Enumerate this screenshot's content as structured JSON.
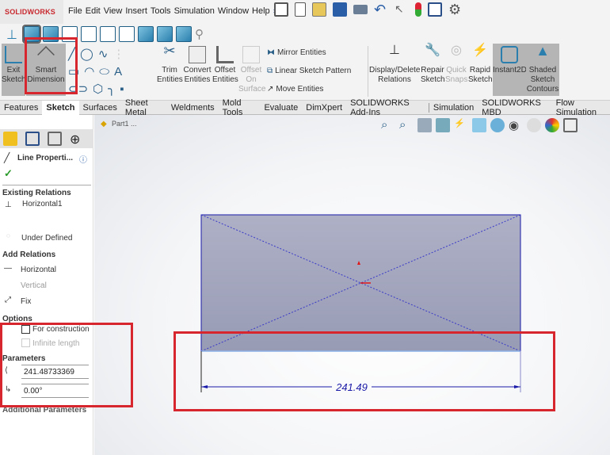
{
  "app": {
    "logo": "SOLIDWORKS"
  },
  "menu": [
    "File",
    "Edit",
    "View",
    "Insert",
    "Tools",
    "Simulation",
    "Window",
    "Help"
  ],
  "quick_access": [
    "home-icon",
    "new-document-icon",
    "open-icon",
    "save-icon",
    "print-icon",
    "undo-icon",
    "select-icon",
    "rebuild-icon",
    "file-properties-icon",
    "options-icon"
  ],
  "ribbon": {
    "exit_sketch": "Exit Sketch",
    "smart_dimension": "Smart Dimension",
    "trim": "Trim Entities",
    "convert": "Convert Entities",
    "offset": "Offset Entities",
    "offset_surface": "Offset On Surface",
    "mirror": "Mirror Entities",
    "linear_pattern": "Linear Sketch Pattern",
    "move": "Move Entities",
    "display_delete": "Display/Delete Relations",
    "repair": "Repair Sketch",
    "quick_snaps": "Quick Snaps",
    "rapid": "Rapid Sketch",
    "instant2d": "Instant2D",
    "shaded": "Shaded Sketch Contours"
  },
  "tabs": [
    {
      "label": "Features"
    },
    {
      "label": "Sketch",
      "active": true
    },
    {
      "label": "Surfaces"
    },
    {
      "label": "Sheet Metal"
    },
    {
      "label": "Weldments"
    },
    {
      "label": "Mold Tools"
    },
    {
      "label": "Evaluate"
    },
    {
      "label": "DimXpert"
    },
    {
      "label": "SOLIDWORKS Add-Ins"
    },
    {
      "label": "Simulation"
    },
    {
      "label": "SOLIDWORKS MBD"
    },
    {
      "label": "Flow Simulation"
    }
  ],
  "tree": {
    "part": "Part1 ..."
  },
  "panel": {
    "title": "Line Properti...",
    "existing_relations": "Existing Relations",
    "relation_1": "Horizontal1",
    "status": "Under Defined",
    "add_relations": "Add Relations",
    "horizontal": "Horizontal",
    "vertical": "Vertical",
    "fix": "Fix",
    "options": "Options",
    "for_construction": "For construction",
    "infinite_length": "Infinite length",
    "for_construction_checked": false,
    "infinite_length_checked": false,
    "parameters": "Parameters",
    "length": "241.48733369",
    "angle": "0.00°",
    "additional_parameters": "Additional Parameters"
  },
  "sketch": {
    "dimension": "241.49",
    "line_color": "#1a1aa8",
    "fill_color": "#9ea2ba"
  },
  "colors": {
    "highlight": "#d7262d",
    "accent": "#2a7fae"
  }
}
